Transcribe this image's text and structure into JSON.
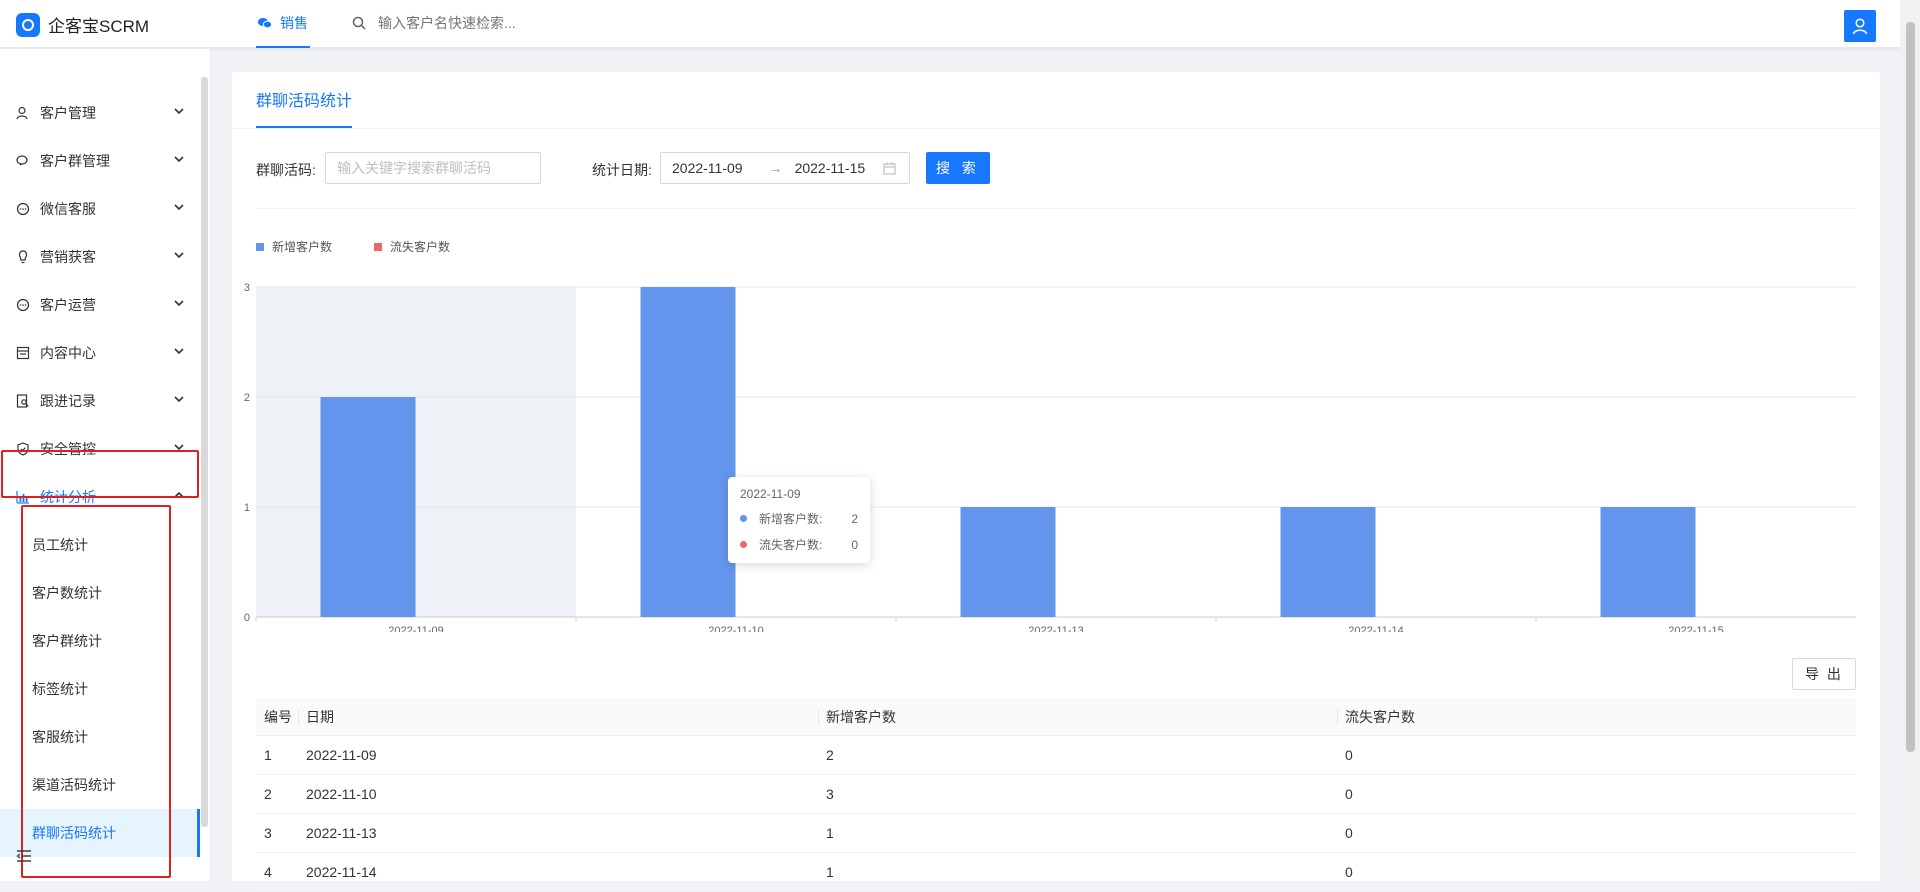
{
  "app": {
    "title": "企客宝SCRM"
  },
  "header": {
    "tab_label": "销售",
    "search_placeholder": "输入客户名快速检索..."
  },
  "sidebar": {
    "items": [
      {
        "label": "客户管理",
        "icon": "user-icon"
      },
      {
        "label": "客户群管理",
        "icon": "chat-bubbles-icon"
      },
      {
        "label": "微信客服",
        "icon": "message-dots-icon"
      },
      {
        "label": "营销获客",
        "icon": "lightbulb-icon"
      },
      {
        "label": "客户运营",
        "icon": "message-dots-icon"
      },
      {
        "label": "内容中心",
        "icon": "document-icon"
      },
      {
        "label": "跟进记录",
        "icon": "record-search-icon"
      },
      {
        "label": "安全管控",
        "icon": "shield-icon"
      },
      {
        "label": "统计分析",
        "icon": "bar-chart-icon"
      }
    ],
    "sub_items": [
      "员工统计",
      "客户数统计",
      "客户群统计",
      "标签统计",
      "客服统计",
      "渠道活码统计",
      "群聊活码统计"
    ],
    "active_sub": "群聊活码统计"
  },
  "page": {
    "tab": "群聊活码统计",
    "filter": {
      "code_label": "群聊活码:",
      "code_placeholder": "输入关键字搜索群聊活码",
      "date_label": "统计日期:",
      "date_start": "2022-11-09",
      "date_arrow": "→",
      "date_end": "2022-11-15",
      "search_button": "搜 索"
    },
    "export_button": "导 出"
  },
  "colors": {
    "accent": "#1677ff",
    "series_new": "#6495ed",
    "series_lost": "#ee6666"
  },
  "chart_data": {
    "type": "bar",
    "categories": [
      "2022-11-09",
      "2022-11-10",
      "2022-11-13",
      "2022-11-14",
      "2022-11-15"
    ],
    "series": [
      {
        "name": "新增客户数",
        "values": [
          2,
          3,
          1,
          1,
          1
        ]
      },
      {
        "name": "流失客户数",
        "values": [
          0,
          0,
          0,
          0,
          0
        ]
      }
    ],
    "ylim": [
      0,
      3
    ],
    "yticks": [
      "0",
      "1",
      "2",
      "3"
    ],
    "grid": true,
    "legend": "top-left",
    "tooltip": {
      "title": "2022-11-09",
      "rows": [
        {
          "name": "新增客户数:",
          "value": "2"
        },
        {
          "name": "流失客户数:",
          "value": "0"
        }
      ]
    }
  },
  "table": {
    "columns": [
      "编号",
      "日期",
      "新增客户数",
      "流失客户数"
    ],
    "rows": [
      [
        "1",
        "2022-11-09",
        "2",
        "0"
      ],
      [
        "2",
        "2022-11-10",
        "3",
        "0"
      ],
      [
        "3",
        "2022-11-13",
        "1",
        "0"
      ],
      [
        "4",
        "2022-11-14",
        "1",
        "0"
      ]
    ]
  }
}
